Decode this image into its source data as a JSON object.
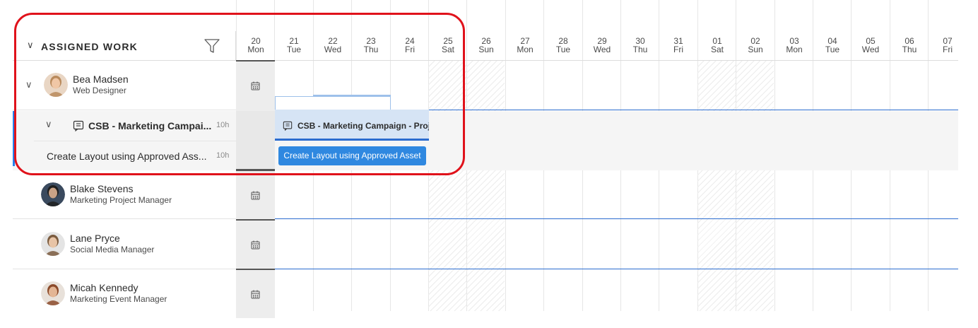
{
  "header": {
    "section_title": "ASSIGNED WORK",
    "chevron_icon": "chevron-down-icon",
    "filter_icon": "filter-icon"
  },
  "days": [
    {
      "num": "20",
      "dow": "Mon"
    },
    {
      "num": "21",
      "dow": "Tue"
    },
    {
      "num": "22",
      "dow": "Wed"
    },
    {
      "num": "23",
      "dow": "Thu"
    },
    {
      "num": "24",
      "dow": "Fri"
    },
    {
      "num": "25",
      "dow": "Sat"
    },
    {
      "num": "26",
      "dow": "Sun"
    },
    {
      "num": "27",
      "dow": "Mon"
    },
    {
      "num": "28",
      "dow": "Tue"
    },
    {
      "num": "29",
      "dow": "Wed"
    },
    {
      "num": "30",
      "dow": "Thu"
    },
    {
      "num": "31",
      "dow": "Fri"
    },
    {
      "num": "01",
      "dow": "Sat"
    },
    {
      "num": "02",
      "dow": "Sun"
    },
    {
      "num": "03",
      "dow": "Mon"
    },
    {
      "num": "04",
      "dow": "Tue"
    },
    {
      "num": "05",
      "dow": "Wed"
    },
    {
      "num": "06",
      "dow": "Thu"
    },
    {
      "num": "07",
      "dow": "Fri"
    }
  ],
  "people": [
    {
      "name": "Bea Madsen",
      "role": "Web Designer"
    },
    {
      "name": "Blake Stevens",
      "role": "Marketing Project Manager"
    },
    {
      "name": "Lane Pryce",
      "role": "Social Media Manager"
    },
    {
      "name": "Micah Kennedy",
      "role": "Marketing Event Manager"
    }
  ],
  "project": {
    "name": "CSB - Marketing Campai...",
    "hours": "10h",
    "bar_label": "CSB - Marketing Campaign - Proje"
  },
  "task": {
    "name": "Create Layout using Approved Ass...",
    "hours": "10h",
    "bar_label": "Create Layout using Approved Asset"
  },
  "colors": {
    "accent": "#2680eb",
    "task_bar": "#2f88e0",
    "project_bar_bg": "#d6e4f5",
    "highlight": "#e0121b"
  }
}
